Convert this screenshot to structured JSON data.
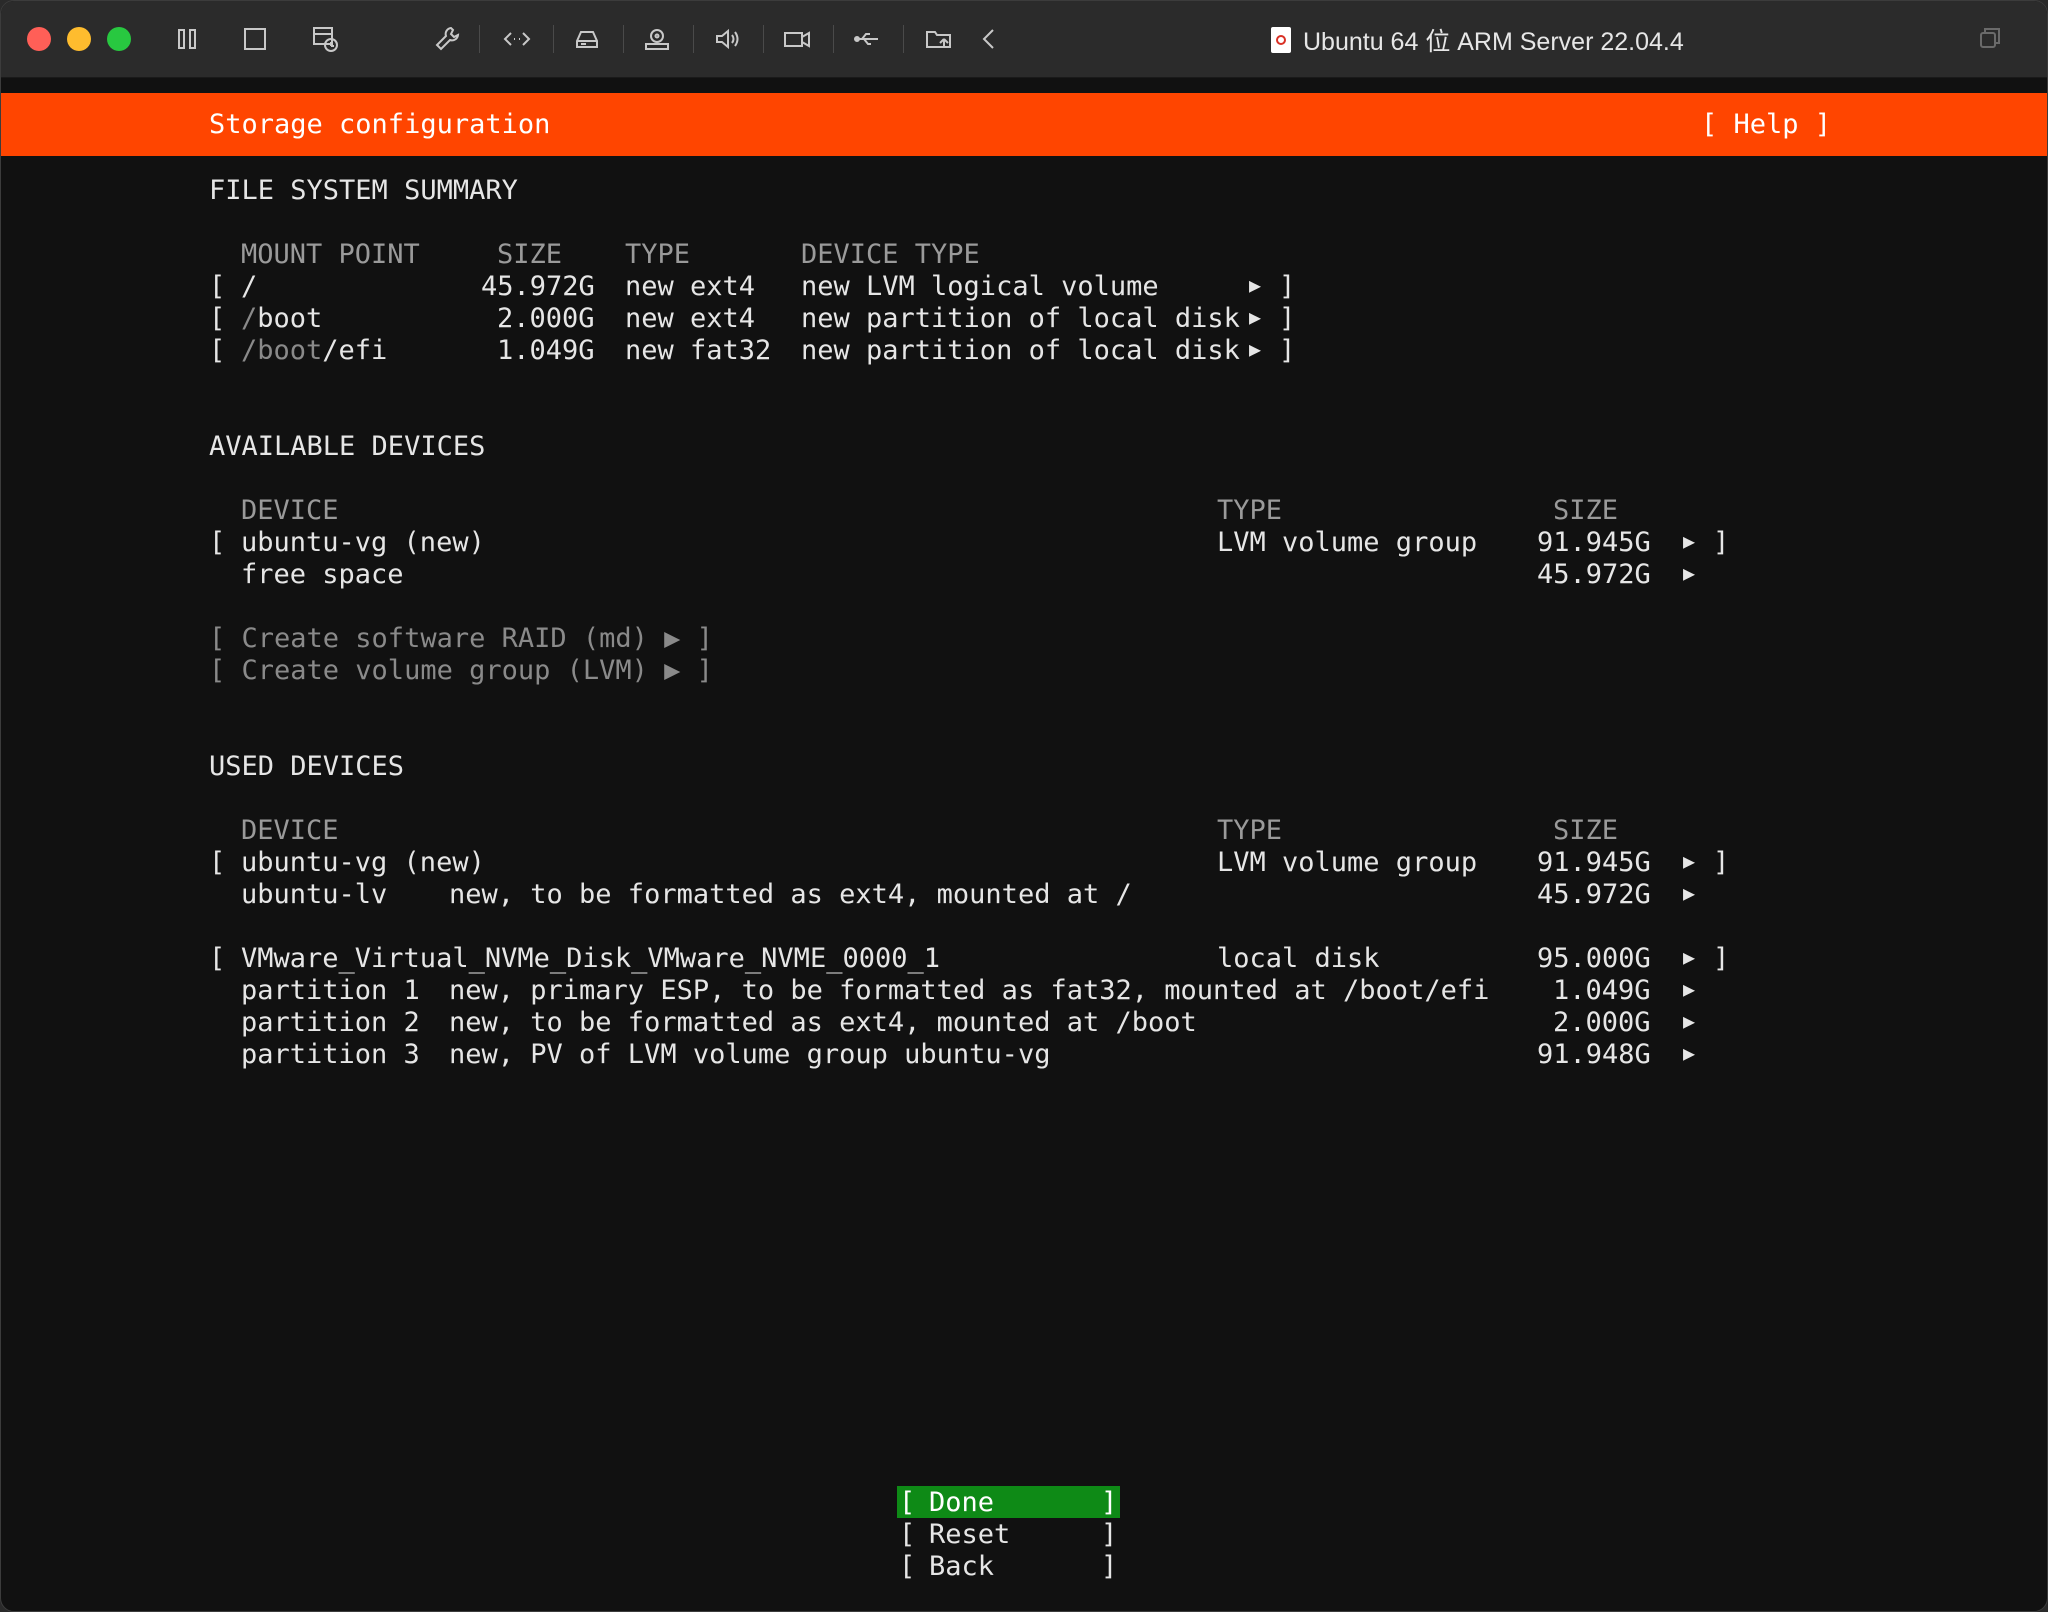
{
  "window": {
    "title": "Ubuntu 64 位 ARM Server 22.04.4"
  },
  "header": {
    "title": "Storage configuration",
    "help": "[ Help ]"
  },
  "fs_summary": {
    "section": "FILE SYSTEM SUMMARY",
    "columns": [
      "MOUNT POINT",
      "SIZE",
      "TYPE",
      "DEVICE TYPE"
    ],
    "rows": [
      {
        "open": "[",
        "mount_dim": "",
        "mount": "/",
        "size": "45.972G",
        "type": "new ext4",
        "device_type": "new LVM logical volume",
        "arrow": "▶",
        "close": "]"
      },
      {
        "open": "[",
        "mount_dim": "/",
        "mount": "boot",
        "size": "2.000G",
        "type": "new ext4",
        "device_type": "new partition of local disk",
        "arrow": "▶",
        "close": "]"
      },
      {
        "open": "[",
        "mount_dim": "/boot",
        "mount": "/efi",
        "size": "1.049G",
        "type": "new fat32",
        "device_type": "new partition of local disk",
        "arrow": "▶",
        "close": "]"
      }
    ]
  },
  "available": {
    "section": "AVAILABLE DEVICES",
    "columns": [
      "DEVICE",
      "TYPE",
      "SIZE"
    ],
    "vg": {
      "open": "[",
      "name": "ubuntu-vg (new)",
      "type": "LVM volume group",
      "size": "91.945G",
      "arrow": "▶",
      "close": "]"
    },
    "free": {
      "name": "free space",
      "size": "45.972G",
      "arrow": "▶"
    },
    "create_raid": "[ Create software RAID (md) ▶ ]",
    "create_lvm": "[ Create volume group (LVM) ▶ ]"
  },
  "used": {
    "section": "USED DEVICES",
    "columns": [
      "DEVICE",
      "TYPE",
      "SIZE"
    ],
    "vg": {
      "open": "[",
      "name": "ubuntu-vg (new)",
      "type": "LVM volume group",
      "size": "91.945G",
      "arrow": "▶",
      "close": "]"
    },
    "lv": {
      "name": "ubuntu-lv",
      "desc": "new, to be formatted as ext4, mounted at /",
      "size": "45.972G",
      "arrow": "▶"
    },
    "disk": {
      "open": "[",
      "name": "VMware_Virtual_NVMe_Disk_VMware_NVME_0000_1",
      "type": "local disk",
      "size": "95.000G",
      "arrow": "▶",
      "close": "]"
    },
    "partitions": [
      {
        "name": "partition 1",
        "desc": "new, primary ESP, to be formatted as fat32, mounted at /boot/efi",
        "size": "1.049G",
        "arrow": "▶"
      },
      {
        "name": "partition 2",
        "desc": "new, to be formatted as ext4, mounted at /boot",
        "size": "2.000G",
        "arrow": "▶"
      },
      {
        "name": "partition 3",
        "desc": "new, PV of LVM volume group ubuntu-vg",
        "size": "91.948G",
        "arrow": "▶"
      }
    ]
  },
  "buttons": {
    "done": {
      "open": "[",
      "label": "Done",
      "close": "]"
    },
    "reset": {
      "open": "[",
      "label": "Reset",
      "close": "]"
    },
    "back": {
      "open": "[",
      "label": "Back",
      "close": "]"
    }
  },
  "colors": {
    "header": "#ff4500",
    "done_bg": "#0e8a16",
    "background": "#111111"
  }
}
